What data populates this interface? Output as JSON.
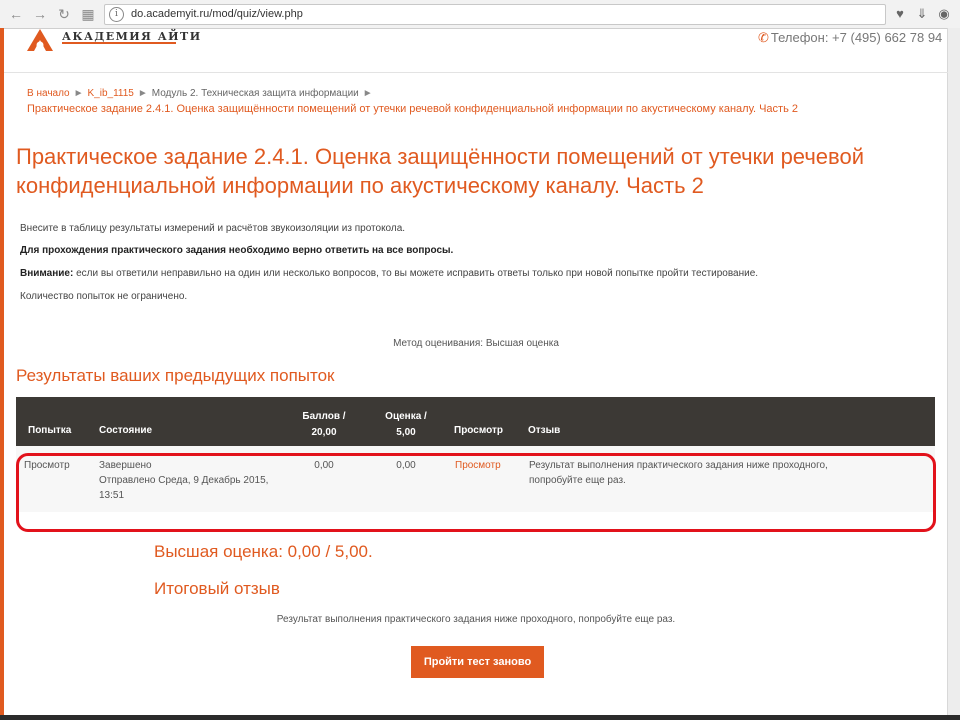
{
  "browser": {
    "url": "do.academyit.ru/mod/quiz/view.php",
    "info_glyph": "i"
  },
  "header": {
    "brand": "АКАДЕМИЯ АЙТИ",
    "phone": "Телефон: +7 (495) 662 78 94"
  },
  "breadcrumb": {
    "items": [
      "В начало",
      "K_ib_1115",
      "Модуль 2. Техническая защита информации"
    ],
    "current": "Практическое задание 2.4.1. Оценка защищённости помещений от утечки речевой конфиденциальной информации по акустическому каналу. Часть 2"
  },
  "page": {
    "title": "Практическое задание 2.4.1. Оценка защищённости помещений от утечки речевой конфиденциальной информации по акустическому каналу. Часть 2"
  },
  "intro": {
    "line1": "Внесите в таблицу результаты измерений и расчётов звукоизоляции из протокола.",
    "line2": "Для прохождения практического задания необходимо верно ответить на все вопросы.",
    "line3_bold": "Внимание:",
    "line3": " если вы ответили неправильно на один или несколько вопросов, то вы можете исправить ответы только при новой попытке пройти тестирование.",
    "line4": "Количество попыток не ограничено."
  },
  "grading_method": "Метод оценивания: Высшая оценка",
  "results": {
    "heading": "Результаты ваших предыдущих попыток",
    "headers": {
      "attempt": "Попытка",
      "state": "Состояние",
      "score_l1": "Баллов /",
      "score_l2": "20,00",
      "grade_l1": "Оценка /",
      "grade_l2": "5,00",
      "review": "Просмотр",
      "feedback": "Отзыв"
    },
    "row": {
      "attempt": "Просмотр",
      "state": "Завершено",
      "submitted_l1": "Отправлено Среда, 9 Декабрь 2015,",
      "submitted_l2": "13:51",
      "score": "0,00",
      "grade": "0,00",
      "review_link": "Просмотр",
      "feedback_l1": "Результат выполнения практического задания ниже проходного,",
      "feedback_l2": "попробуйте еще раз."
    }
  },
  "best_grade": "Высшая оценка: 0,00 / 5,00.",
  "final_feedback": {
    "heading": "Итоговый отзыв",
    "text": "Результат выполнения практического задания ниже проходного, попробуйте еще раз."
  },
  "retry_button": "Пройти тест заново",
  "colors": {
    "accent": "#e05a20",
    "table_header": "#3c3935",
    "highlight": "#e2121b"
  }
}
